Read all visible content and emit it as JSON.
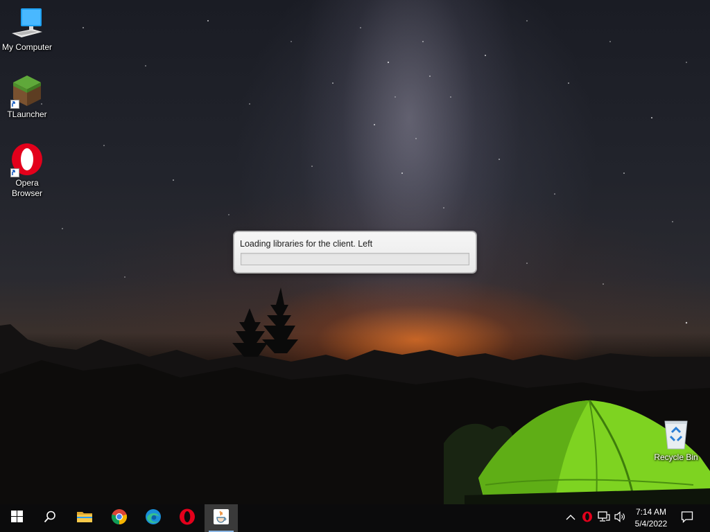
{
  "desktop": {
    "icons": [
      {
        "label": "My Computer",
        "icon": "computer-icon"
      },
      {
        "label": "TLauncher",
        "icon": "minecraft-grass-block-icon"
      },
      {
        "label": "Opera Browser",
        "icon": "opera-icon"
      },
      {
        "label": "Recycle Bin",
        "icon": "recycle-bin-icon"
      }
    ]
  },
  "dialog": {
    "message": "Loading libraries for the client. Left",
    "progress": 0,
    "progress_color": "#06b025"
  },
  "taskbar": {
    "pinned": [
      {
        "name": "start",
        "icon": "windows-logo-icon"
      },
      {
        "name": "search",
        "icon": "search-icon"
      },
      {
        "name": "file-explorer",
        "icon": "folder-icon"
      },
      {
        "name": "chrome",
        "icon": "chrome-icon"
      },
      {
        "name": "edge",
        "icon": "edge-icon"
      },
      {
        "name": "opera",
        "icon": "opera-icon"
      },
      {
        "name": "java",
        "icon": "java-icon",
        "active": true
      }
    ],
    "tray": {
      "icons": [
        "chevron-up-icon",
        "opera-tray-icon",
        "network-icon",
        "volume-icon"
      ],
      "time": "7:14 AM",
      "date": "5/4/2022",
      "notification_icon": "action-center-icon"
    },
    "accent_color": "#8cb8e6"
  }
}
